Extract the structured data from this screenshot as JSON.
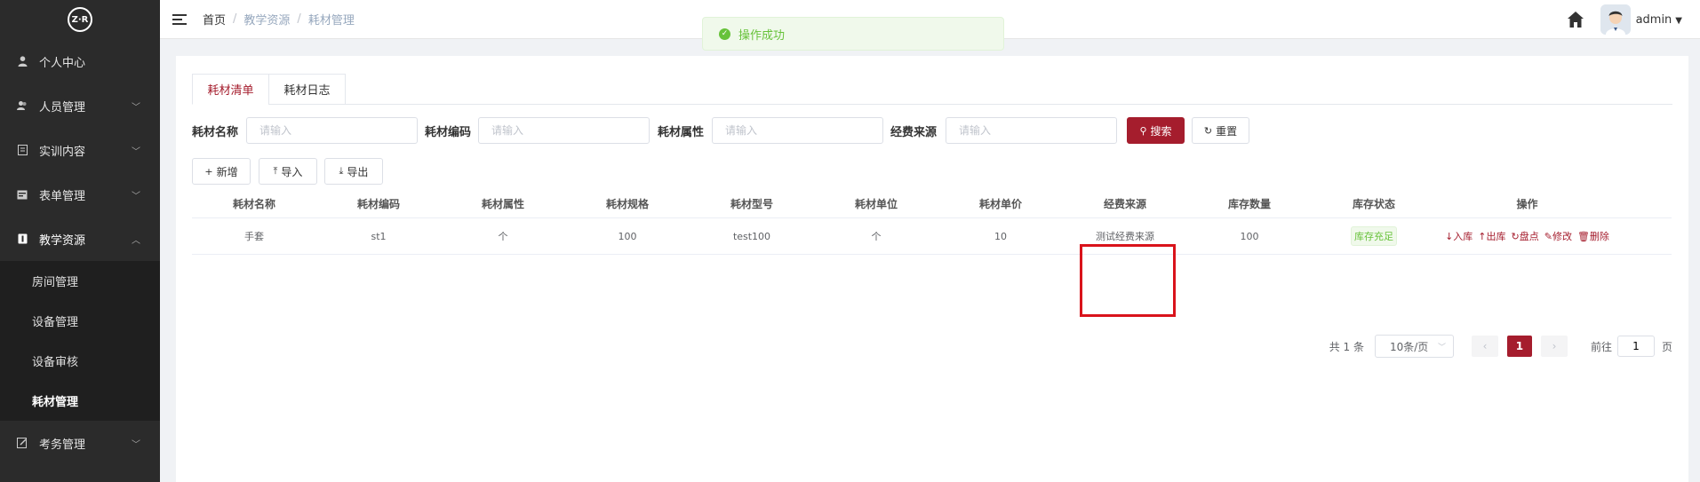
{
  "logo": {
    "text": "Z·R"
  },
  "sidebar": {
    "items": [
      {
        "label": "个人中心",
        "icon": "user-icon",
        "has_children": false
      },
      {
        "label": "人员管理",
        "icon": "users-icon",
        "has_children": true
      },
      {
        "label": "实训内容",
        "icon": "content-icon",
        "has_children": true
      },
      {
        "label": "表单管理",
        "icon": "form-icon",
        "has_children": true
      },
      {
        "label": "教学资源",
        "icon": "resource-icon",
        "has_children": true,
        "expanded": true
      },
      {
        "label": "考务管理",
        "icon": "exam-icon",
        "has_children": true
      }
    ],
    "sub_items": [
      {
        "label": "房间管理"
      },
      {
        "label": "设备管理"
      },
      {
        "label": "设备审核"
      },
      {
        "label": "耗材管理",
        "active": true
      }
    ]
  },
  "topbar": {
    "breadcrumb": [
      "首页",
      "教学资源",
      "耗材管理"
    ],
    "user": "admin"
  },
  "toast": {
    "message": "操作成功"
  },
  "tabs": [
    {
      "label": "耗材清单",
      "active": true
    },
    {
      "label": "耗材日志",
      "active": false
    }
  ],
  "search": {
    "fields": [
      {
        "label": "耗材名称",
        "placeholder": "请输入"
      },
      {
        "label": "耗材编码",
        "placeholder": "请输入"
      },
      {
        "label": "耗材属性",
        "placeholder": "请输入"
      },
      {
        "label": "经费来源",
        "placeholder": "请输入"
      }
    ],
    "search_label": "搜索",
    "reset_label": "重置"
  },
  "actions": {
    "add": "新增",
    "import": "导入",
    "export": "导出"
  },
  "table": {
    "headers": [
      "耗材名称",
      "耗材编码",
      "耗材属性",
      "耗材规格",
      "耗材型号",
      "耗材单位",
      "耗材单价",
      "经费来源",
      "库存数量",
      "库存状态",
      "操作"
    ],
    "rows": [
      {
        "name": "手套",
        "code": "st1",
        "attr": "个",
        "spec": "100",
        "model": "test100",
        "unit": "个",
        "price": "10",
        "fund": "测试经费来源",
        "qty": "100",
        "status": "库存充足",
        "ops": [
          "入库",
          "出库",
          "盘点",
          "修改",
          "删除"
        ]
      }
    ]
  },
  "pager": {
    "total": "共 1 条",
    "page_size": "10条/页",
    "current": "1",
    "goto_prefix": "前往",
    "goto_value": "1",
    "goto_suffix": "页"
  },
  "colors": {
    "accent": "#a51d2d",
    "sidebar_bg": "#2b2b2b",
    "success": "#67c23a",
    "highlight": "#d9131b"
  }
}
